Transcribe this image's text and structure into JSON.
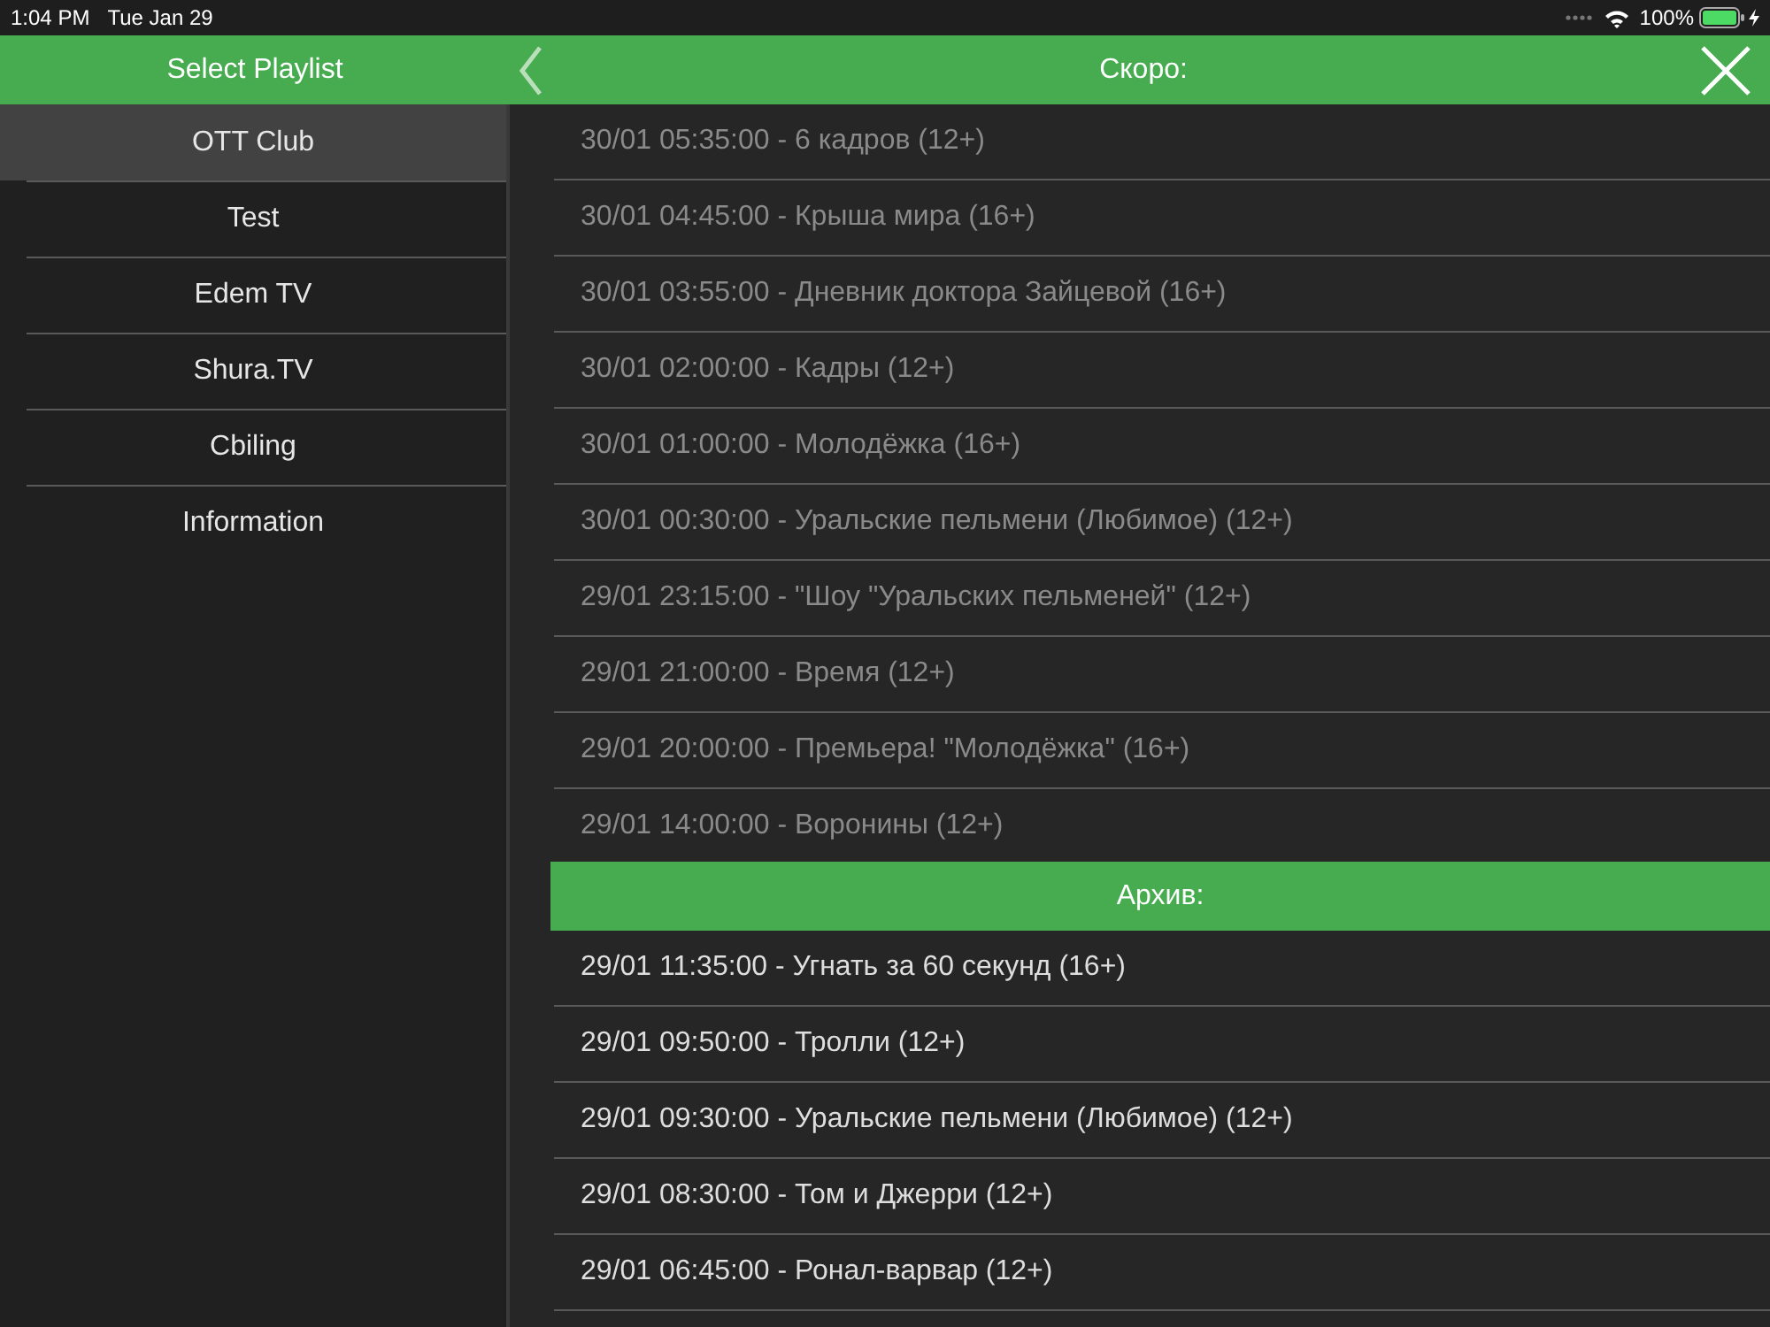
{
  "status_bar": {
    "time": "1:04 PM",
    "date": "Tue Jan 29",
    "battery": "100%"
  },
  "header": {
    "playlist_title": "Select Playlist",
    "title": "Скоро:"
  },
  "sidebar": {
    "items": [
      {
        "label": "OTT Club",
        "selected": true
      },
      {
        "label": "Test",
        "selected": false
      },
      {
        "label": "Edem TV",
        "selected": false
      },
      {
        "label": "Shura.TV",
        "selected": false
      },
      {
        "label": "Cbiling",
        "selected": false
      },
      {
        "label": "Information",
        "selected": false
      }
    ]
  },
  "upcoming": [
    {
      "text": "30/01 05:35:00 - 6 кадров (12+)",
      "dimmed": true
    },
    {
      "text": "30/01 04:45:00 - Крыша мира (16+)",
      "dimmed": true
    },
    {
      "text": "30/01 03:55:00 - Дневник доктора Зайцевой (16+)",
      "dimmed": true
    },
    {
      "text": "30/01 02:00:00 - Кадры (12+)",
      "dimmed": true
    },
    {
      "text": "30/01 01:00:00 - Молодёжка (16+)",
      "dimmed": true
    },
    {
      "text": "30/01 00:30:00 - Уральские пельмени (Любимое) (12+)",
      "dimmed": true
    },
    {
      "text": "29/01 23:15:00 - \"Шоу \"Уральских пельменей\" (12+)",
      "dimmed": true
    },
    {
      "text": "29/01 21:00:00 - Время (12+)",
      "dimmed": true
    },
    {
      "text": "29/01 20:00:00 - Премьера! \"Молодёжка\" (16+)",
      "dimmed": true
    },
    {
      "text": "29/01 14:00:00 - Воронины (12+)",
      "dimmed": true
    }
  ],
  "archive": {
    "title": "Архив:",
    "items": [
      {
        "text": "29/01 11:35:00 - Угнать за 60 секунд (16+)",
        "dimmed": false
      },
      {
        "text": "29/01 09:50:00 - Тролли (12+)",
        "dimmed": false
      },
      {
        "text": "29/01 09:30:00 - Уральские пельмени (Любимое) (12+)",
        "dimmed": false
      },
      {
        "text": "29/01 08:30:00 - Том и Джерри (12+)",
        "dimmed": false
      },
      {
        "text": "29/01 06:45:00 - Ронал-варвар (12+)",
        "dimmed": false
      }
    ]
  }
}
